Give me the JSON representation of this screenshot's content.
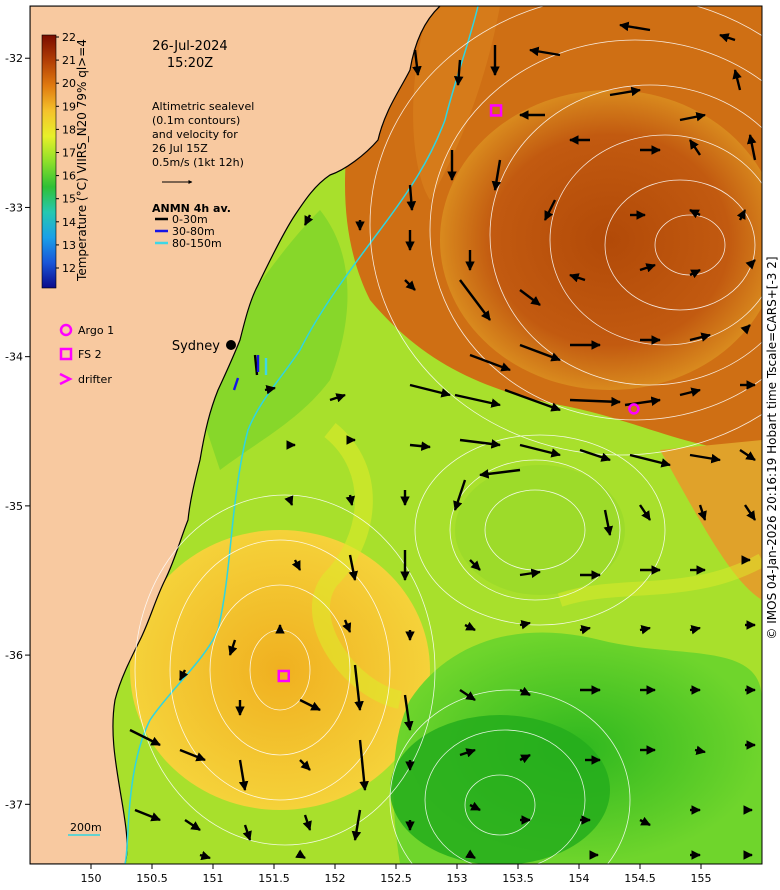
{
  "header": {
    "date": "26-Jul-2024",
    "time": "15:20Z"
  },
  "altimetry_note": {
    "lines": [
      "Altimetric sealevel",
      "(0.1m contours)",
      "and velocity for",
      "26 Jul 15Z",
      "0.5m/s (1kt 12h)"
    ]
  },
  "anmn_legend": {
    "title": "ANMN 4h av.",
    "items": [
      {
        "label": "0-30m",
        "color": "#000000"
      },
      {
        "label": "30-80m",
        "color": "#1515e6"
      },
      {
        "label": "80-150m",
        "color": "#3fd7e6"
      }
    ]
  },
  "platform_legend": {
    "items": [
      {
        "label": "Argo 1",
        "symbol": "circle",
        "color": "#ff00ff"
      },
      {
        "label": "FS 2",
        "symbol": "square",
        "color": "#ff00ff"
      },
      {
        "label": "drifter",
        "symbol": "chevron",
        "color": "#ff00ff"
      }
    ]
  },
  "colorbar": {
    "label": "Temperature (°C) VIIRS_N20 79% ql>=4",
    "ticks": [
      "22",
      "21",
      "20",
      "19",
      "18",
      "17",
      "16",
      "15",
      "14",
      "13",
      "12"
    ]
  },
  "place_label": "Sydney",
  "scale_label": "200m",
  "x_axis": {
    "ticks": [
      {
        "label": "150",
        "value": 150
      },
      {
        "label": "150.5",
        "value": 150.5
      },
      {
        "label": "151",
        "value": 151
      },
      {
        "label": "151.5",
        "value": 151.5
      },
      {
        "label": "152",
        "value": 152
      },
      {
        "label": "152.5",
        "value": 152.5
      },
      {
        "label": "153",
        "value": 153
      },
      {
        "label": "153.5",
        "value": 153.5
      },
      {
        "label": "154",
        "value": 154
      },
      {
        "label": "154.5",
        "value": 154.5
      },
      {
        "label": "155",
        "value": 155
      }
    ]
  },
  "y_axis": {
    "ticks": [
      {
        "label": "-32",
        "value": -32
      },
      {
        "label": "-33",
        "value": -33
      },
      {
        "label": "-34",
        "value": -34
      },
      {
        "label": "-35",
        "value": -35
      },
      {
        "label": "-36",
        "value": -36
      },
      {
        "label": "-37",
        "value": -37
      }
    ]
  },
  "credit": "© IMOS 04-Jan-2026 20:16:19 Hobart time Tscale=CARS+[-3 2]",
  "markers": [
    {
      "type": "square",
      "lon": 153.32,
      "lat": -32.35,
      "color": "#ff00ff"
    },
    {
      "type": "circle",
      "lon": 154.45,
      "lat": -34.35,
      "color": "#ff00ff"
    },
    {
      "type": "square",
      "lon": 151.58,
      "lat": -36.14,
      "color": "#ff00ff"
    }
  ],
  "colors": {
    "land": "#f8c9a0",
    "coast": "#000000",
    "isobath": "#30d5e0",
    "contour": "#ffffff",
    "arrow": "#000000"
  }
}
